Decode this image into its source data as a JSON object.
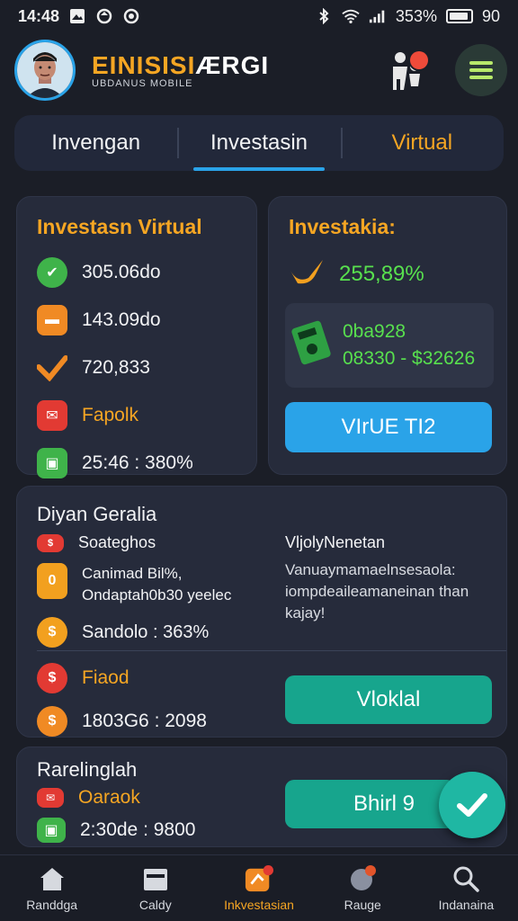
{
  "status": {
    "time": "14:48",
    "battery_text": "353%",
    "battery_level": "90"
  },
  "header": {
    "brand_a": "EINISISI",
    "brand_b": "ÆRGI",
    "brand_sub": "UBDANUS MOBILE"
  },
  "tabs": [
    {
      "label": "Invengan"
    },
    {
      "label": "Investasin"
    },
    {
      "label": "Virtual"
    }
  ],
  "card_virtual": {
    "title": "Investasn Virtual",
    "rows": [
      {
        "icon": "check-icon",
        "value": "305.06do"
      },
      {
        "icon": "cash-icon",
        "value": "143.09do"
      },
      {
        "icon": "trend-icon",
        "value": "720,833"
      },
      {
        "icon": "chat-icon",
        "value": "Fapolk"
      },
      {
        "icon": "wallet-icon",
        "value": "25:46 : 380%"
      }
    ]
  },
  "card_invest": {
    "title": "Investakia:",
    "percent": "255,89%",
    "code_1": "0ba928",
    "code_2": "08330 - $32626",
    "button": "VIrUE TI2"
  },
  "card_general": {
    "title": "Diyan Geralia",
    "left_rows": [
      {
        "icon": "badge-icon",
        "text": "Soateghos"
      },
      {
        "icon": "note-icon",
        "text": "Canimad Bil%,\nOndaptah0b30 yeelec"
      },
      {
        "icon": "coin-icon",
        "text": "Sandolo : 363%"
      }
    ],
    "right_title": "VljolyNenetan",
    "right_text": "Vanuaymamaelnsesaola: iompdeaileamaneinan than kajay!",
    "bottom_rows": [
      {
        "icon": "dollar-icon",
        "text": "Fiaod"
      },
      {
        "icon": "money-bag-icon",
        "text": "1803G6 : 2098"
      }
    ],
    "button": "Vloklal"
  },
  "card_bottom": {
    "title": "Rarelinglah",
    "rows": [
      {
        "icon": "chat-icon",
        "text": "Oaraok"
      },
      {
        "icon": "wallet-icon",
        "text": "2:30de : 9800"
      }
    ],
    "button": "Bhirl 9"
  },
  "nav": [
    {
      "label": "Randdga"
    },
    {
      "label": "Caldy"
    },
    {
      "label": "Inkvestasian"
    },
    {
      "label": "Rauge"
    },
    {
      "label": "Indanaina"
    }
  ]
}
